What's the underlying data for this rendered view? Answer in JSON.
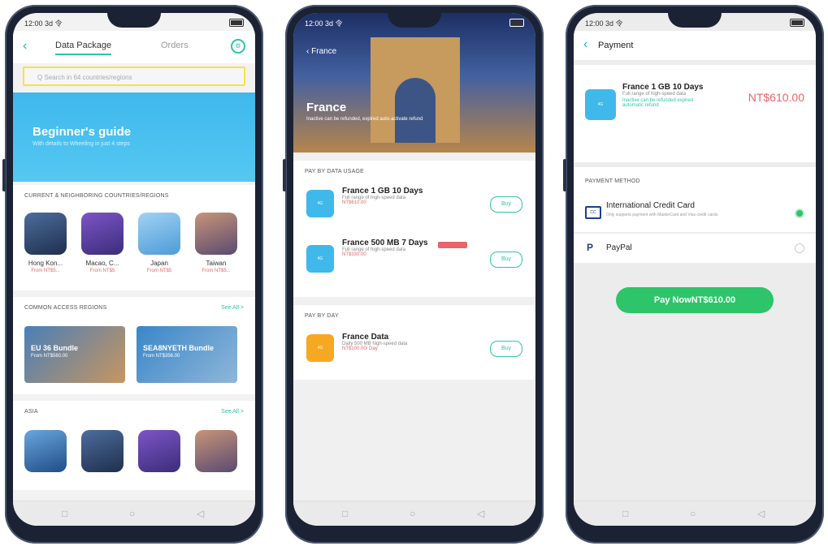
{
  "status": {
    "time": "12:00 3d 令"
  },
  "phone1": {
    "tabs": [
      "Data Package",
      "Orders"
    ],
    "search_placeholder": "Q Search in 64 countries/regions",
    "guide_title": "Beginner's guide",
    "guide_sub": "With details to Wheeling in just 4 steps",
    "sections": {
      "current": "CURRENT & NEIGHBORING COUNTRIES/REGIONS",
      "common": "COMMON ACCESS REGIONS",
      "asia": "ASIA",
      "see_all": "See All >"
    },
    "destinations": [
      {
        "name": "Hong Kon...",
        "price": "From NT$5..."
      },
      {
        "name": "Macao, C...",
        "price": "From NT$5"
      },
      {
        "name": "Japan",
        "price": "From NT$5"
      },
      {
        "name": "Taiwan",
        "price": "From NT$5..."
      }
    ],
    "bundles": [
      {
        "title": "EU 36 Bundle",
        "sub": "From NT$560.00"
      },
      {
        "title": "SEA8NYETH Bundle",
        "sub": "From NT$356.00"
      }
    ]
  },
  "phone2": {
    "back_title": "France",
    "country": "France",
    "hero_note": "Inactive can be refunded, expired auto-activate refund",
    "section_usage": "PAY BY DATA USAGE",
    "section_day": "PAY BY DAY",
    "packages": [
      {
        "title": "France 1 GB 10 Days",
        "desc": "Full range of high-speed data",
        "price": "NT$610.00",
        "buy": "Buy"
      },
      {
        "title": "France 500 MB 7 Days",
        "desc": "Full range of high-speed data",
        "price": "NT$330.00",
        "buy": "Buy"
      },
      {
        "title": "France Data",
        "desc": "Daily 500 MB high-speed data",
        "price": "NT$100.00/ Day",
        "buy": "Buy"
      }
    ]
  },
  "phone3": {
    "title": "Payment",
    "product_title": "France 1 GB 10 Days",
    "product_desc": "Full range of high-speed data",
    "product_note": "Inactive can be refunded expired automatic refund",
    "price": "NT$610.00",
    "payment_method": "PAYMENT METHOD",
    "methods": [
      {
        "name": "International Credit Card",
        "desc": "Only supports payment with MasterCard and Visa credit cards"
      },
      {
        "name": "PayPal",
        "desc": ""
      }
    ],
    "pay_button": "Pay NowNT$610.00"
  },
  "colors": {
    "accent": "#2ec4a5",
    "pay": "#2ec46a",
    "price": "#e9646a",
    "sky": "#3fb8ec"
  },
  "icons": [
    "back-icon",
    "settings-icon",
    "search-icon",
    "credit-card-icon",
    "paypal-icon"
  ]
}
